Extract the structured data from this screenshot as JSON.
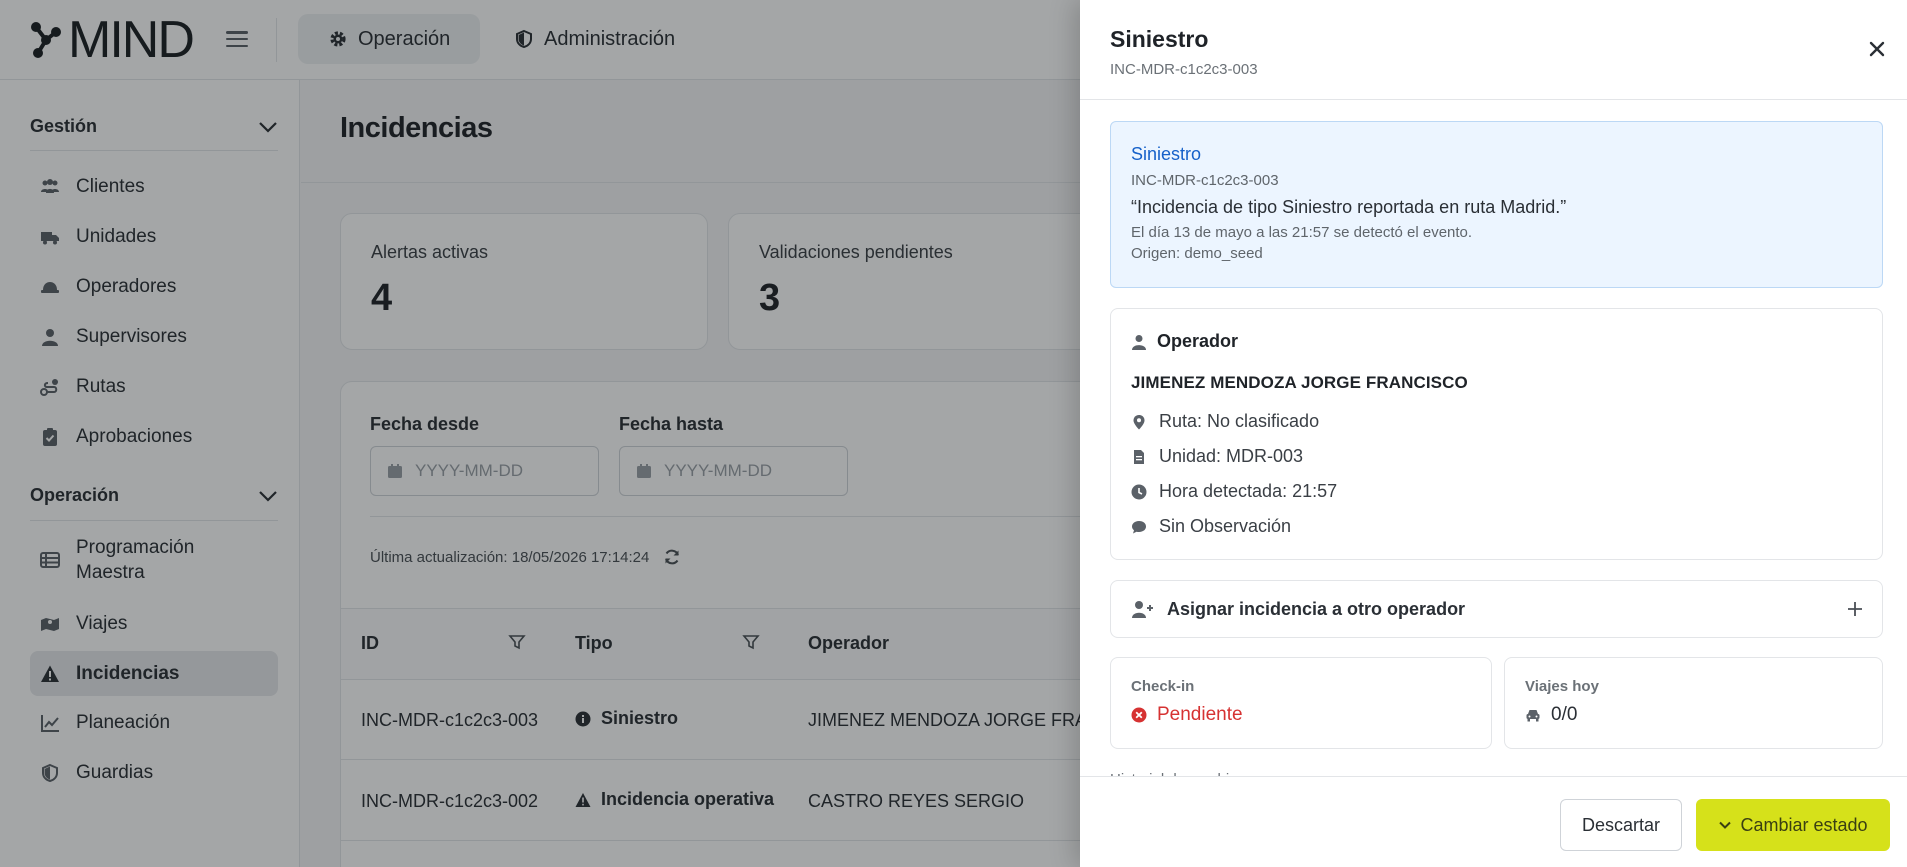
{
  "app": {
    "logo_text": "MIND"
  },
  "top_tabs": [
    {
      "label": "Operación",
      "icon": "gear-icon",
      "active": true
    },
    {
      "label": "Administración",
      "icon": "shield-icon",
      "active": false
    }
  ],
  "sidebar": {
    "sections": [
      {
        "label": "Gestión",
        "items": [
          {
            "label": "Clientes",
            "icon": "users-icon"
          },
          {
            "label": "Unidades",
            "icon": "truck-icon"
          },
          {
            "label": "Operadores",
            "icon": "hardhat-icon"
          },
          {
            "label": "Supervisores",
            "icon": "user-tie-icon"
          },
          {
            "label": "Rutas",
            "icon": "route-icon"
          },
          {
            "label": "Aprobaciones",
            "icon": "clipboard-check-icon"
          }
        ]
      },
      {
        "label": "Operación",
        "items": [
          {
            "label": "Programación Maestra",
            "icon": "table-list-icon"
          },
          {
            "label": "Viajes",
            "icon": "map-location-icon"
          },
          {
            "label": "Incidencias",
            "icon": "warning-icon",
            "active": true
          },
          {
            "label": "Planeación",
            "icon": "chart-line-icon"
          },
          {
            "label": "Guardias",
            "icon": "shield-icon"
          }
        ]
      }
    ]
  },
  "main": {
    "title": "Incidencias",
    "stats": [
      {
        "label": "Alertas activas",
        "value": "4"
      },
      {
        "label": "Validaciones pendientes",
        "value": "3"
      }
    ],
    "filters": {
      "date_from_label": "Fecha desde",
      "date_from_placeholder": "YYYY-MM-DD",
      "date_to_label": "Fecha hasta",
      "date_to_placeholder": "YYYY-MM-DD"
    },
    "last_update": "Última actualización: 18/05/2026 17:14:24",
    "table": {
      "headers": [
        "ID",
        "Tipo",
        "Operador"
      ],
      "rows": [
        {
          "id": "INC-MDR-c1c2c3-003",
          "type": "Siniestro",
          "type_icon": "info-circle-icon",
          "operator": "JIMENEZ MENDOZA JORGE FRANCISCO"
        },
        {
          "id": "INC-MDR-c1c2c3-002",
          "type": "Incidencia operativa",
          "type_icon": "warning-icon",
          "operator": "CASTRO REYES SERGIO"
        }
      ]
    }
  },
  "drawer": {
    "title": "Siniestro",
    "subtitle": "INC-MDR-c1c2c3-003",
    "info": {
      "title": "Siniestro",
      "code": "INC-MDR-c1c2c3-003",
      "quote": "“Incidencia de tipo Siniestro reportada en ruta Madrid.”",
      "detected": "El día 13 de mayo a las 21:57 se detectó el evento.",
      "origin": "Origen: demo_seed"
    },
    "operator": {
      "heading": "Operador",
      "name": "JIMENEZ MENDOZA JORGE FRANCISCO",
      "ruta": "Ruta: No clasificado",
      "unidad": "Unidad: MDR-003",
      "hora": "Hora detectada: 21:57",
      "observacion": "Sin Observación"
    },
    "assign_label": "Asignar incidencia a otro operador",
    "checkin": {
      "label": "Check-in",
      "value": "Pendiente",
      "color": "#d63232"
    },
    "viajes": {
      "label": "Viajes hoy",
      "value": "0/0"
    },
    "history_peek": "Historial de cambios",
    "buttons": {
      "discard": "Descartar",
      "change_state": "Cambiar estado"
    }
  },
  "colors": {
    "accent": "#d6e11a",
    "info_bg": "#ecf5ff",
    "info_title": "#1661c9",
    "danger": "#d63232"
  }
}
